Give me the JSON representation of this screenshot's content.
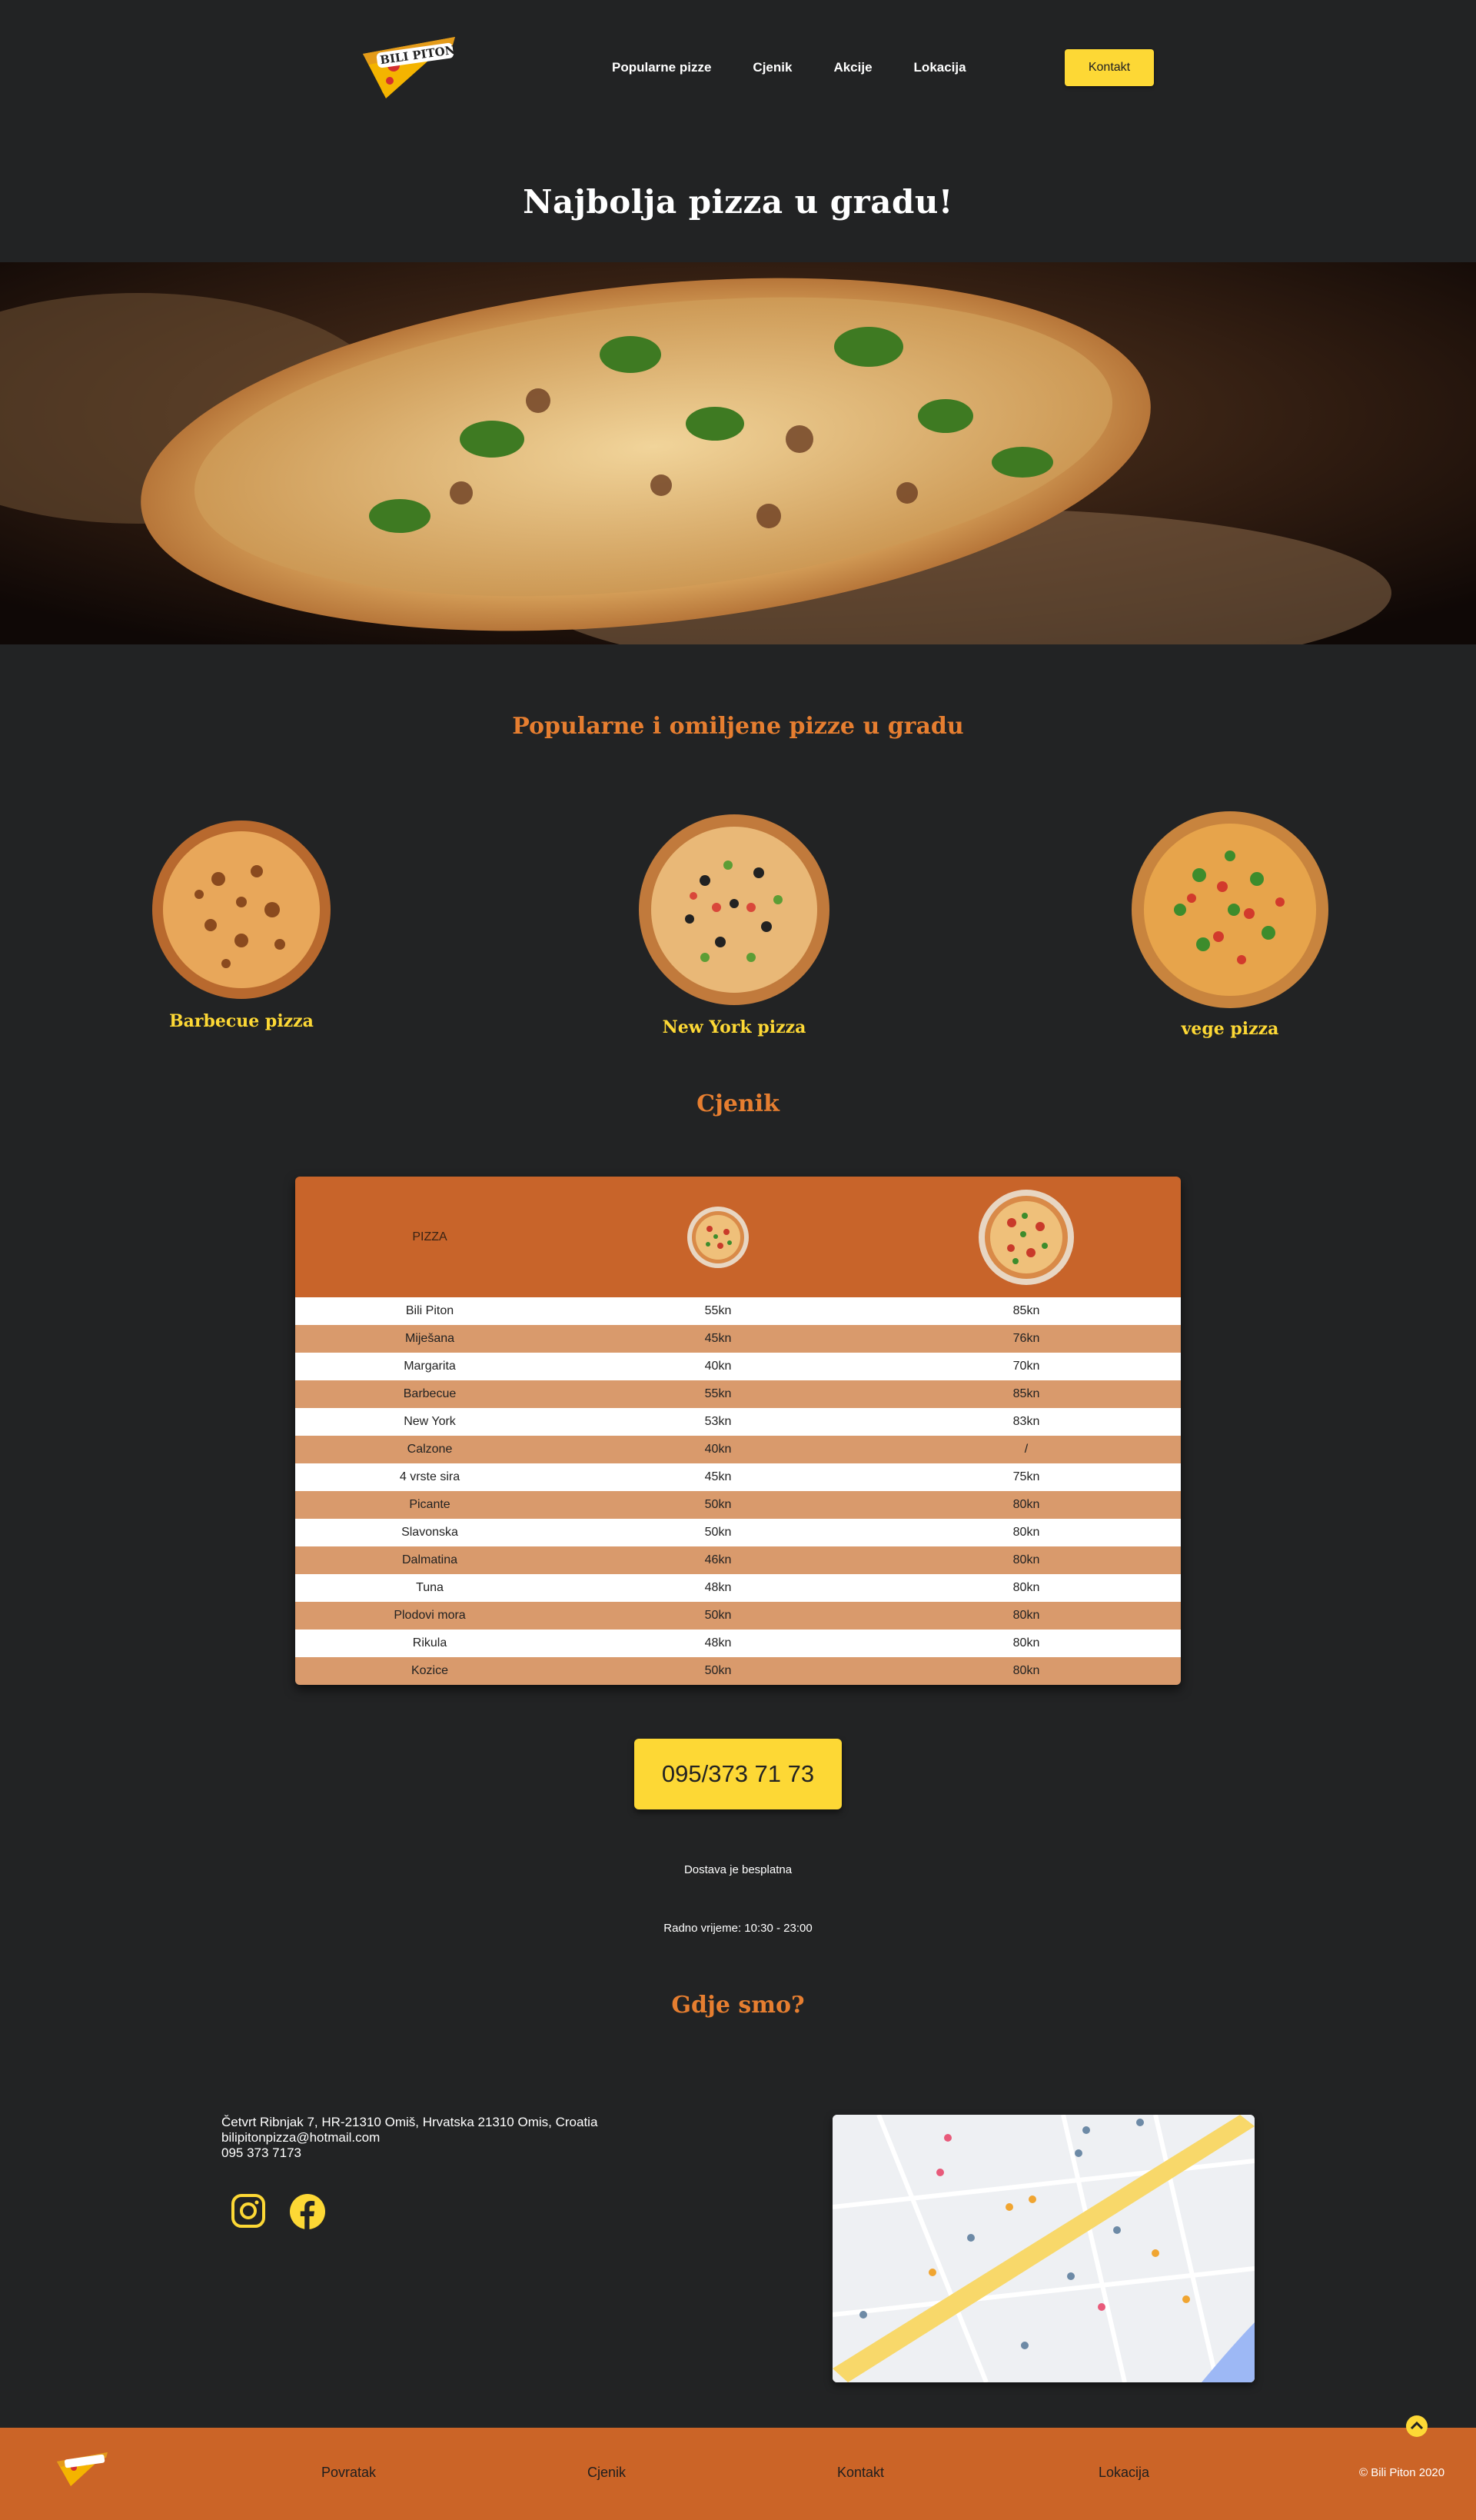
{
  "header": {
    "logo_text": "Bili Piton",
    "nav": [
      {
        "label": "Popularne pizze"
      },
      {
        "label": "Cjenik"
      },
      {
        "label": "Akcije"
      },
      {
        "label": "Lokacija"
      }
    ],
    "contact_label": "Kontakt"
  },
  "hero": {
    "title": "Najbolja pizza u gradu!"
  },
  "popular": {
    "title": "Popularne i omiljene pizze u gradu",
    "pizzas": [
      {
        "name": "Barbecue pizza"
      },
      {
        "name": "New York pizza"
      },
      {
        "name": "vege pizza"
      }
    ]
  },
  "pricelist": {
    "title": "Cjenik",
    "header_label": "PIZZA",
    "rows": [
      {
        "name": "Bili Piton",
        "small": "55kn",
        "large": "85kn"
      },
      {
        "name": "Miješana",
        "small": "45kn",
        "large": "76kn"
      },
      {
        "name": "Margarita",
        "small": "40kn",
        "large": "70kn"
      },
      {
        "name": "Barbecue",
        "small": "55kn",
        "large": "85kn"
      },
      {
        "name": "New York",
        "small": "53kn",
        "large": "83kn"
      },
      {
        "name": "Calzone",
        "small": "40kn",
        "large": "/"
      },
      {
        "name": "4 vrste sira",
        "small": "45kn",
        "large": "75kn"
      },
      {
        "name": "Picante",
        "small": "50kn",
        "large": "80kn"
      },
      {
        "name": "Slavonska",
        "small": "50kn",
        "large": "80kn"
      },
      {
        "name": "Dalmatina",
        "small": "46kn",
        "large": "80kn"
      },
      {
        "name": "Tuna",
        "small": "48kn",
        "large": "80kn"
      },
      {
        "name": "Plodovi mora",
        "small": "50kn",
        "large": "80kn"
      },
      {
        "name": "Rikula",
        "small": "48kn",
        "large": "80kn"
      },
      {
        "name": "Kozice",
        "small": "50kn",
        "large": "80kn"
      }
    ]
  },
  "order": {
    "phone": "095/373 71 73",
    "delivery": "Dostava je besplatna",
    "hours": "Radno vrijeme: 10:30 - 23:00"
  },
  "location": {
    "title": "Gdje smo?",
    "address": "Četvrt Ribnjak 7, HR-21310 Omiš, Hrvatska 21310 Omis, Croatia",
    "email": "bilipitonpizza@hotmail.com",
    "phone": "095 373 7173",
    "social": [
      {
        "icon": "instagram-icon"
      },
      {
        "icon": "facebook-icon"
      }
    ]
  },
  "footer": {
    "links": [
      {
        "label": "Povratak"
      },
      {
        "label": "Cjenik"
      },
      {
        "label": "Kontakt"
      },
      {
        "label": "Lokacija"
      }
    ],
    "copyright": "© Bili Piton 2020"
  },
  "colors": {
    "background": "#222324",
    "accent_yellow": "#fdd835",
    "accent_orange": "#e67e30",
    "table_header": "#c8642a",
    "table_alt_row": "#d99a6c",
    "footer": "#cb6427"
  }
}
